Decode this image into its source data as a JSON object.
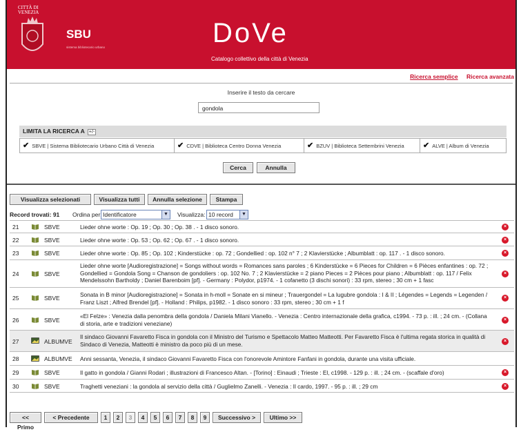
{
  "header": {
    "citta": "CITTÀ DI\nVENEZIA",
    "sbu": "SBU",
    "sbu_sub": "sistema bibliotecario urbano",
    "title": "DoVe",
    "subtitle": "Catalogo collettivo della città di Venezia",
    "links": [
      "Ricerca semplice",
      "Ricerca avanzata"
    ]
  },
  "search": {
    "prompt": "Inserire il testo da cercare",
    "value": "gondola"
  },
  "limita": {
    "label": "LIMITA LA RICERCA A",
    "toggle": "+/-",
    "libraries": [
      "SBVE | Sistema Bibliotecario Urbano Città di Venezia",
      "CDVE | Biblioteca Centro Donna Venezia",
      "BZUV | Biblioteca Settembrini Venezia",
      "ALVE | Album di Venezia"
    ]
  },
  "actions": {
    "search": "Cerca",
    "reset": "Annulla"
  },
  "toolbar": [
    "Visualizza selezionati",
    "Visualizza tutti",
    "Annulla selezione",
    "Stampa"
  ],
  "records": {
    "found_label": "Record trovati: 91",
    "order_label": "Ordina per:",
    "order_value": "Identificatore",
    "view_label": "Visualizza:",
    "view_value": "10 record"
  },
  "results": [
    {
      "num": "21",
      "src": "SBVE",
      "icon": "book-icon",
      "text": "Lieder ohne worte : Op. 19 ; Op. 30 ; Op. 38 . - 1 disco sonoro."
    },
    {
      "num": "22",
      "src": "SBVE",
      "icon": "book-icon",
      "text": "Lieder ohne worte : Op. 53 ; Op. 62 ; Op. 67 . - 1 disco sonoro."
    },
    {
      "num": "23",
      "src": "SBVE",
      "icon": "book-icon",
      "text": "Lieder ohne worte : Op. 85 ; Op. 102 ; Kinderstücke : op. 72 ; Gondellied : op. 102 n° 7 ; 2 Klavierstücke ; Albumblatt : op. 117 . - 1 disco sonoro."
    },
    {
      "num": "24",
      "src": "SBVE",
      "icon": "book-icon",
      "text": "Lieder ohne worte [Audioregistrazione] = Songs without words = Romances sans paroles ; 6 Kinderstücke = 6 Pieces for Children = 6 Pièces enfantines : op. 72 ; Gondellied = Gondola Song = Chanson de gondoliers : op. 102 No. 7 ; 2 Klavierstücke = 2 piano Pieces = 2 Pièces pour piano ; Albumblatt : op. 117 / Felix Mendelssohn Bartholdy ; Daniel Barenboim [pf]. - Germany : Polydor, p1974. - 1 cofanetto (3 dischi sonori) : 33 rpm, stereo ; 30 cm + 1 fasc"
    },
    {
      "num": "25",
      "src": "SBVE",
      "icon": "book-icon",
      "text": "Sonata in B minor [Audioregistrazione] = Sonata in h-moll = Sonate en si mineur ; Trauergondel = La lugubre gondola : I & II ; Légendes = Legends = Legenden / Franz Liszt ; Alfred Brendel [pf]. - Holland : Philips, p1982. - 1 disco sonoro : 33 rpm, stereo ; 30 cm + 1 f"
    },
    {
      "num": "26",
      "src": "SBVE",
      "icon": "book-icon",
      "text": "«El Felze» : Venezia dalla penombra della gondola / Daniela Milani Vianello. - Venezia : Centro internazionale della grafica, c1994. - 73 p. : ill. ; 24 cm. - (Collana di storia, arte e tradizioni veneziane)"
    },
    {
      "num": "27",
      "src": "ALBUMVE",
      "icon": "photo-icon",
      "text": "Il sindaco Giovanni Favaretto Fisca in gondola con il Ministro del Turismo e Spettacolo Matteo Matteotti. Per Favaretto Fisca è l'ultima regata storica in qualità di Sindaco di Venezia, Matteotti è ministro da poco più di un mese."
    },
    {
      "num": "28",
      "src": "ALBUMVE",
      "icon": "photo-icon",
      "text": "Anni sessanta, Venezia, il sindaco Giovanni Favaretto Fisca con l'onorevole Amintore Fanfani in gondola, durante una visita ufficiale."
    },
    {
      "num": "29",
      "src": "SBVE",
      "icon": "book-icon",
      "text": "Il gatto in gondola / Gianni Rodari ; illustrazioni di Francesco Altan. - [Torino] : Einaudi ; Trieste : El, c1998. - 129 p. : ill. ; 24 cm. - (scaffale d'oro)"
    },
    {
      "num": "30",
      "src": "SBVE",
      "icon": "book-icon",
      "text": "Traghetti veneziani : la gondola al servizio della città / Guglielmo Zanelli. - Venezia : Il cardo, 1997. - 95 p. : ill. ; 29 cm"
    }
  ],
  "pager": {
    "first": "<< Primo",
    "prev": "< Precedente",
    "pages": [
      "1",
      "2",
      "3",
      "4",
      "5",
      "6",
      "7",
      "8",
      "9"
    ],
    "current": "3",
    "next": "Successivo >",
    "last": "Ultimo >>"
  },
  "colors": {
    "brand": "#c8102e",
    "row_shade": "#ececec"
  }
}
